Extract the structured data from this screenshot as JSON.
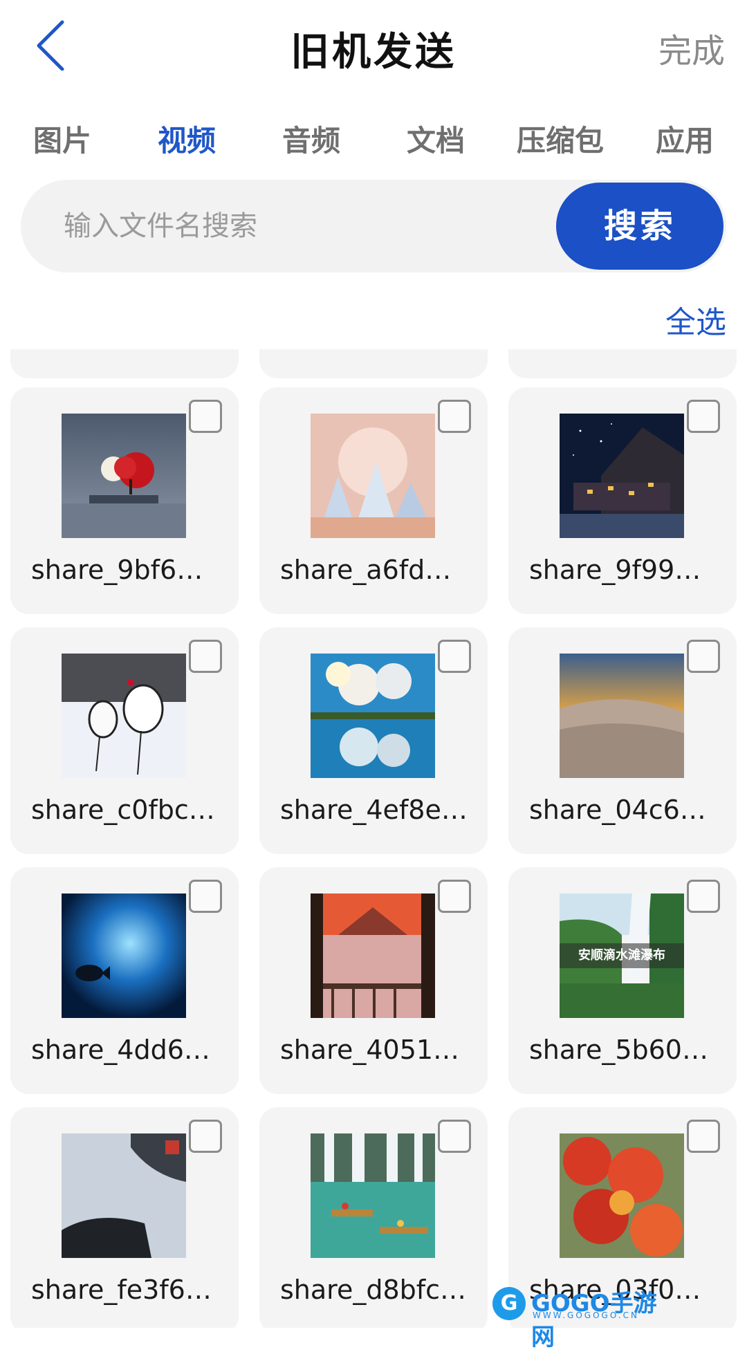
{
  "header": {
    "title": "旧机发送",
    "done_label": "完成"
  },
  "tabs": [
    {
      "label": "图片",
      "active": false
    },
    {
      "label": "视频",
      "active": true
    },
    {
      "label": "音频",
      "active": false
    },
    {
      "label": "文档",
      "active": false
    },
    {
      "label": "压缩包",
      "active": false
    },
    {
      "label": "应用",
      "active": false
    }
  ],
  "search": {
    "placeholder": "输入文件名搜索",
    "button_label": "搜索"
  },
  "select_all_label": "全选",
  "files": [
    {
      "name": "share_9bf6…",
      "checked": false,
      "thumb": "moon-red-tree"
    },
    {
      "name": "share_a6fd…",
      "checked": false,
      "thumb": "snowy-forest"
    },
    {
      "name": "share_9f99…",
      "checked": false,
      "thumb": "night-village"
    },
    {
      "name": "share_c0fbc…",
      "checked": false,
      "thumb": "cranes-snow"
    },
    {
      "name": "share_4ef8e…",
      "checked": false,
      "thumb": "cloud-reflection"
    },
    {
      "name": "share_04c6…",
      "checked": false,
      "thumb": "reed-sunset"
    },
    {
      "name": "share_4dd6…",
      "checked": false,
      "thumb": "underwater-fish"
    },
    {
      "name": "share_4051…",
      "checked": false,
      "thumb": "volcano-sunset"
    },
    {
      "name": "share_5b60…",
      "checked": false,
      "thumb": "waterfall",
      "caption": "安顺滴水滩瀑布"
    },
    {
      "name": "share_fe3f6…",
      "checked": false,
      "thumb": "car-interior"
    },
    {
      "name": "share_d8bfc…",
      "checked": false,
      "thumb": "waterfall-rafts"
    },
    {
      "name": "share_03f0…",
      "checked": false,
      "thumb": "red-foliage"
    }
  ],
  "watermark": {
    "logo": "G",
    "text": "GOGO手游网",
    "sub": "WWW.GOGOGO.CN"
  },
  "colors": {
    "accent": "#1b50c6",
    "tab_active": "#1f57c8",
    "card_bg": "#f4f4f4"
  }
}
